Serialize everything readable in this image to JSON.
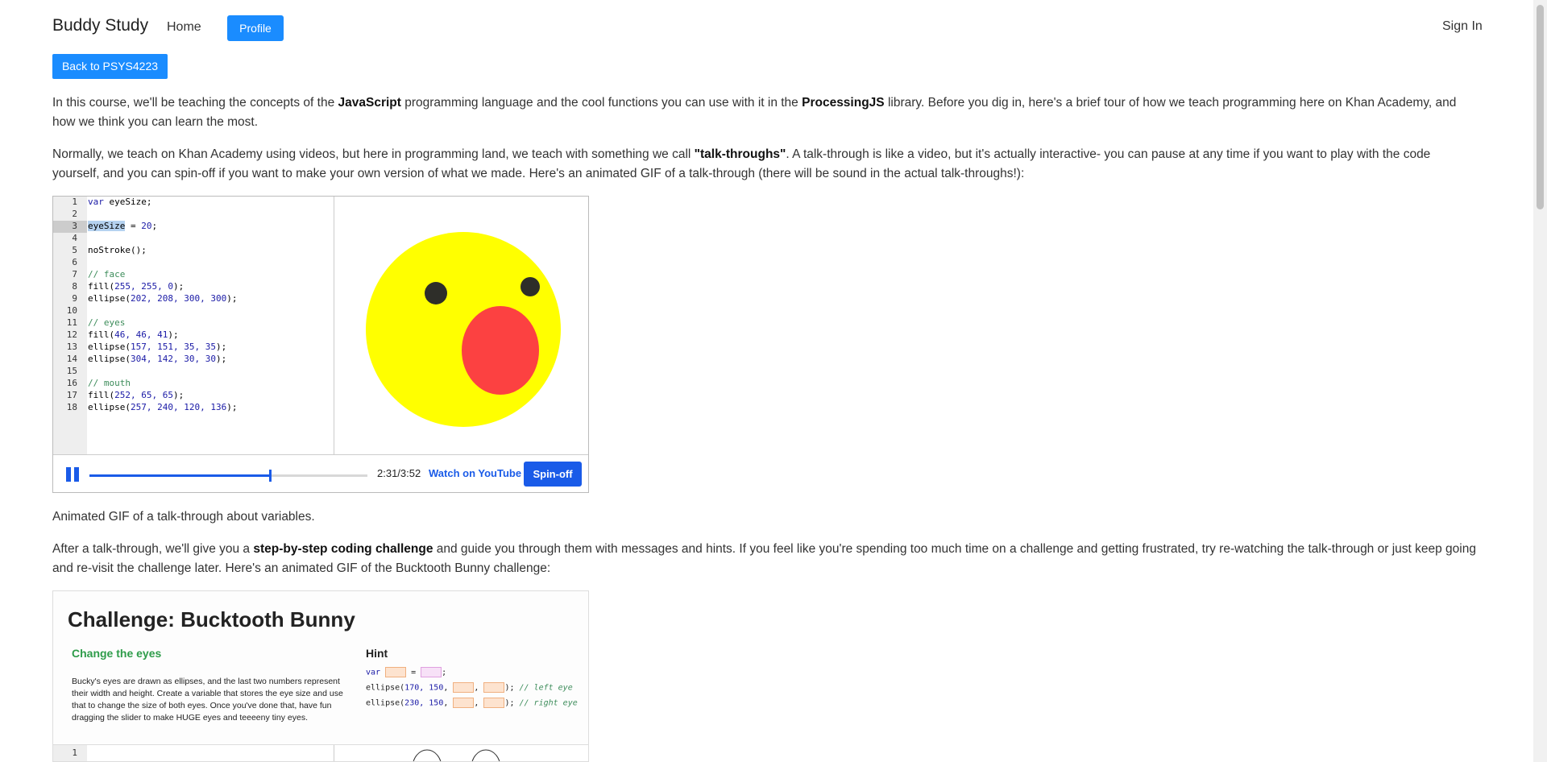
{
  "nav": {
    "brand": "Buddy Study",
    "home": "Home",
    "profile": "Profile",
    "sign_in": "Sign In"
  },
  "back_button": "Back to PSYS4223",
  "paragraphs": {
    "p1": {
      "a": "In this course, we'll be teaching the concepts of the ",
      "b1": "JavaScript",
      "c": " programming language and the cool functions you can use with it in the ",
      "b2": "ProcessingJS",
      "d": " library. Before you dig in, here's a brief tour of how we teach programming here on Khan Academy, and how we think you can learn the most."
    },
    "p2": {
      "a": "Normally, we teach on Khan Academy using videos, but here in programming land, we teach with something we call ",
      "b1": "\"talk-throughs\"",
      "c": ". A talk-through is like a video, but it's actually interactive- you can pause at any time if you want to play with the code yourself, and you can spin-off if you want to make your own version of what we made.  Here's an animated GIF of a talk-through (there will be sound in the actual talk-throughs!):"
    },
    "caption": "Animated GIF of a talk-through about variables.",
    "p3": {
      "a": "After a talk-through, we'll give you a ",
      "b1": "step-by-step coding challenge",
      "c": " and guide you through them with messages and hints. If you feel like you're spending too much time on a challenge and getting frustrated, try re-watching the talk-through or just keep going and re-visit the challenge later. Here's an animated GIF of the Bucktooth Bunny challenge:"
    }
  },
  "talkthrough": {
    "line_numbers": [
      "1",
      "2",
      "3",
      "4",
      "5",
      "6",
      "7",
      "8",
      "9",
      "10",
      "11",
      "12",
      "13",
      "14",
      "15",
      "16",
      "17",
      "18"
    ],
    "code": {
      "l1_kw": "var",
      "l1_rest": " eyeSize;",
      "l3_sel": "eyeSize",
      "l3_eq": " = ",
      "l3_num": "20",
      "l3_end": ";",
      "l5": "noStroke();",
      "l7": "// face",
      "l8_a": "fill(",
      "l8_n": "255, 255, 0",
      "l8_b": ");",
      "l9_a": "ellipse(",
      "l9_n": "202, 208, 300, 300",
      "l9_b": ");",
      "l11": "// eyes",
      "l12_a": "fill(",
      "l12_n": "46, 46, 41",
      "l12_b": ");",
      "l13_a": "ellipse(",
      "l13_n": "157, 151, 35, 35",
      "l13_b": ");",
      "l14_a": "ellipse(",
      "l14_n": "304, 142, 30, 30",
      "l14_b": ");",
      "l16": "// mouth",
      "l17_a": "fill(",
      "l17_n": "252, 65, 65",
      "l17_b": ");",
      "l18_a": "ellipse(",
      "l18_n": "257, 240, 120, 136",
      "l18_b": ");"
    },
    "progress": 0.65,
    "time": "2:31/3:52",
    "watch_youtube": "Watch on YouTube",
    "spin_off": "Spin-off",
    "colors": {
      "face": "#ffff00",
      "eyes": "#2e2e29",
      "mouth": "#fc4141",
      "accent": "#1a5be8"
    }
  },
  "challenge": {
    "title": "Challenge: Bucktooth Bunny",
    "step": "Change the eyes",
    "description": "Bucky's eyes are drawn as ellipses, and the last two numbers represent their width and height. Create a variable that stores the eye size and use that to change the size of both eyes. Once you've done that, have fun dragging the slider to make HUGE eyes and teeeeny tiny eyes.",
    "hint_label": "Hint",
    "hint": {
      "l1_kw": "var",
      "l1_eq": " = ",
      "l2_a": "ellipse(",
      "l2_n": "170, 150",
      "l2_comment": "// left eye",
      "l3_a": "ellipse(",
      "l3_n": "230, 150",
      "l3_comment": "// right eye"
    },
    "lower_line": "1"
  }
}
